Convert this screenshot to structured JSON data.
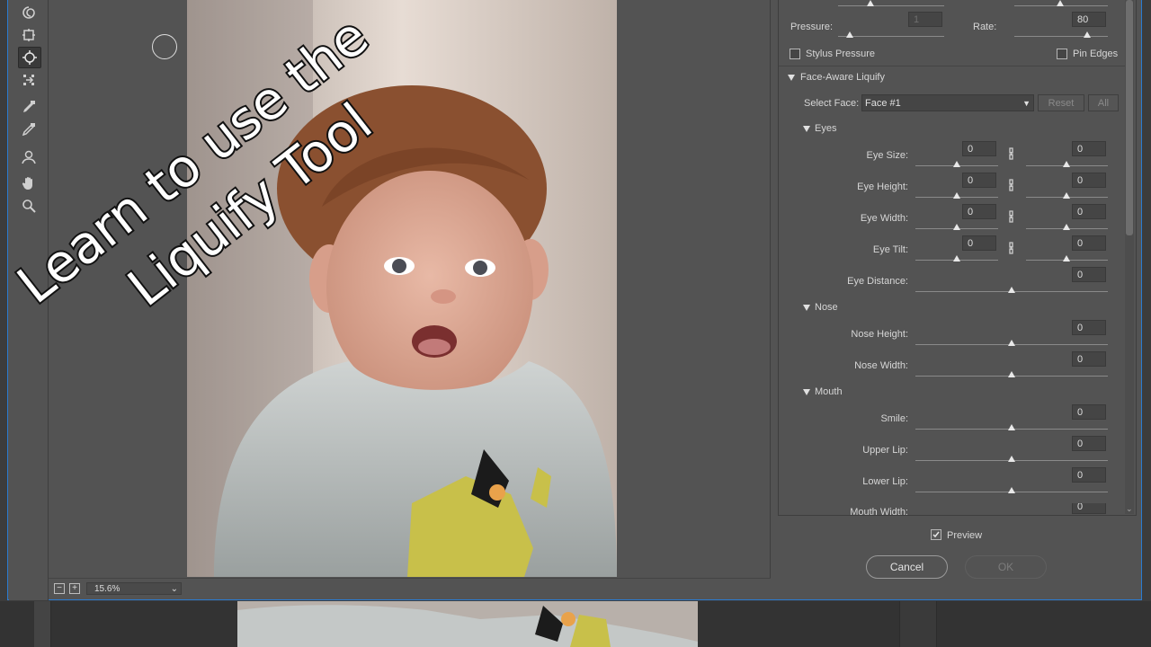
{
  "colors": {
    "accent_border": "#2a7bd1",
    "panel_bg": "#535353",
    "dark_bg": "#3c3c3c"
  },
  "tools": [
    {
      "icon": "twirl-icon"
    },
    {
      "icon": "pucker-icon"
    },
    {
      "icon": "bloat-icon"
    },
    {
      "icon": "push-left-icon"
    },
    {
      "icon": "freeze-mask-icon"
    },
    {
      "icon": "thaw-mask-icon"
    },
    {
      "icon": "face-tool-icon"
    },
    {
      "icon": "hand-icon"
    },
    {
      "icon": "zoom-icon"
    }
  ],
  "overlay_title": {
    "line1": "Learn to use the",
    "line2": "Liquify Tool"
  },
  "statusbar": {
    "zoom": "15.6%"
  },
  "brush": {
    "pressure_label": "Pressure:",
    "pressure_value": "1",
    "rate_label": "Rate:",
    "rate_value": "80",
    "stylus_label": "Stylus Pressure",
    "pin_edges_label": "Pin Edges"
  },
  "face_aware": {
    "header": "Face-Aware Liquify",
    "select_face_label": "Select Face:",
    "selected_face": "Face #1",
    "reset_label": "Reset",
    "all_label": "All",
    "eyes": {
      "header": "Eyes",
      "rows": [
        {
          "label": "Eye Size:",
          "left": "0",
          "right": "0"
        },
        {
          "label": "Eye Height:",
          "left": "0",
          "right": "0"
        },
        {
          "label": "Eye Width:",
          "left": "0",
          "right": "0"
        },
        {
          "label": "Eye Tilt:",
          "left": "0",
          "right": "0"
        }
      ],
      "distance_label": "Eye Distance:",
      "distance_value": "0"
    },
    "nose": {
      "header": "Nose",
      "rows": [
        {
          "label": "Nose Height:",
          "value": "0"
        },
        {
          "label": "Nose Width:",
          "value": "0"
        }
      ]
    },
    "mouth": {
      "header": "Mouth",
      "rows": [
        {
          "label": "Smile:",
          "value": "0"
        },
        {
          "label": "Upper Lip:",
          "value": "0"
        },
        {
          "label": "Lower Lip:",
          "value": "0"
        },
        {
          "label": "Mouth Width:",
          "value": "0"
        }
      ]
    }
  },
  "footer": {
    "preview_label": "Preview",
    "cancel_label": "Cancel",
    "ok_label": "OK"
  }
}
